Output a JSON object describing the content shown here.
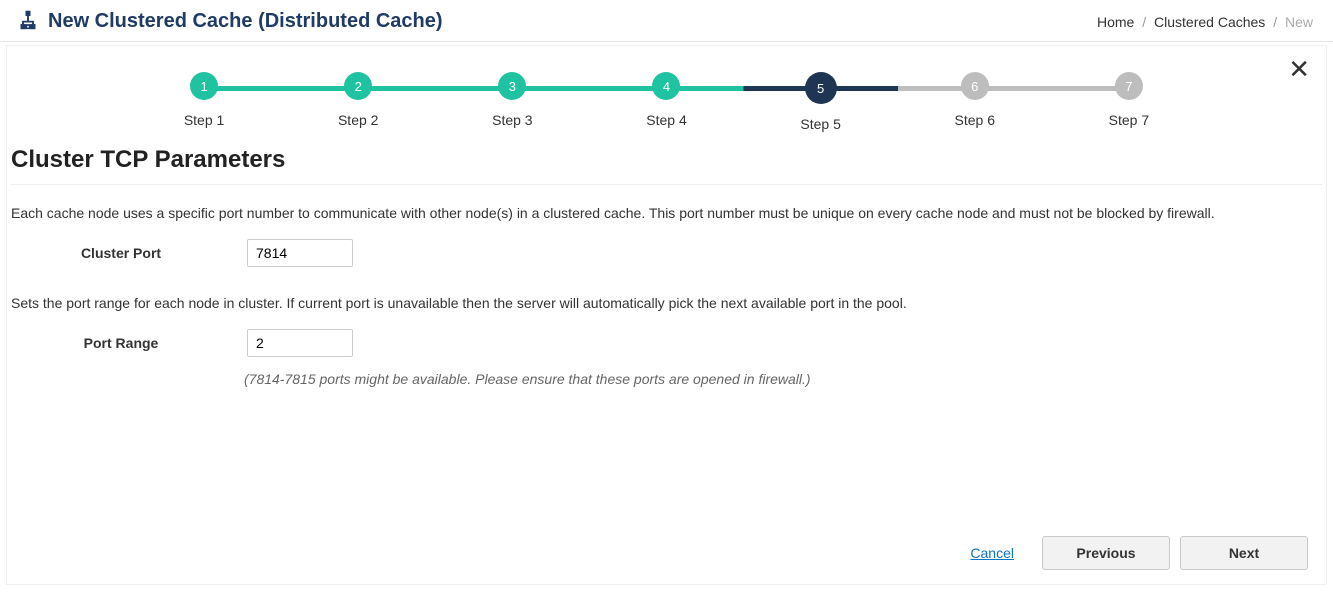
{
  "header": {
    "title": "New Clustered Cache (Distributed Cache)"
  },
  "breadcrumb": {
    "home": "Home",
    "mid": "Clustered Caches",
    "current": "New"
  },
  "stepper": {
    "steps": [
      {
        "num": "1",
        "label": "Step 1",
        "state": "done"
      },
      {
        "num": "2",
        "label": "Step 2",
        "state": "done"
      },
      {
        "num": "3",
        "label": "Step 3",
        "state": "done"
      },
      {
        "num": "4",
        "label": "Step 4",
        "state": "done"
      },
      {
        "num": "5",
        "label": "Step 5",
        "state": "current"
      },
      {
        "num": "6",
        "label": "Step 6",
        "state": "upcoming"
      },
      {
        "num": "7",
        "label": "Step 7",
        "state": "upcoming"
      }
    ]
  },
  "section": {
    "title": "Cluster TCP Parameters",
    "desc1": "Each cache node uses a specific port number to communicate with other node(s) in a clustered cache. This port number must be unique on every cache node and must not be blocked by firewall.",
    "desc2": "Sets the port range for each node in cluster. If current port is unavailable then the server will automatically pick the next available port in the pool."
  },
  "form": {
    "cluster_port_label": "Cluster Port",
    "cluster_port_value": "7814",
    "port_range_label": "Port Range",
    "port_range_value": "2",
    "hint": "(7814-7815 ports might be available. Please ensure that these ports are opened in firewall.)"
  },
  "footer": {
    "cancel": "Cancel",
    "prev": "Previous",
    "next": "Next"
  }
}
